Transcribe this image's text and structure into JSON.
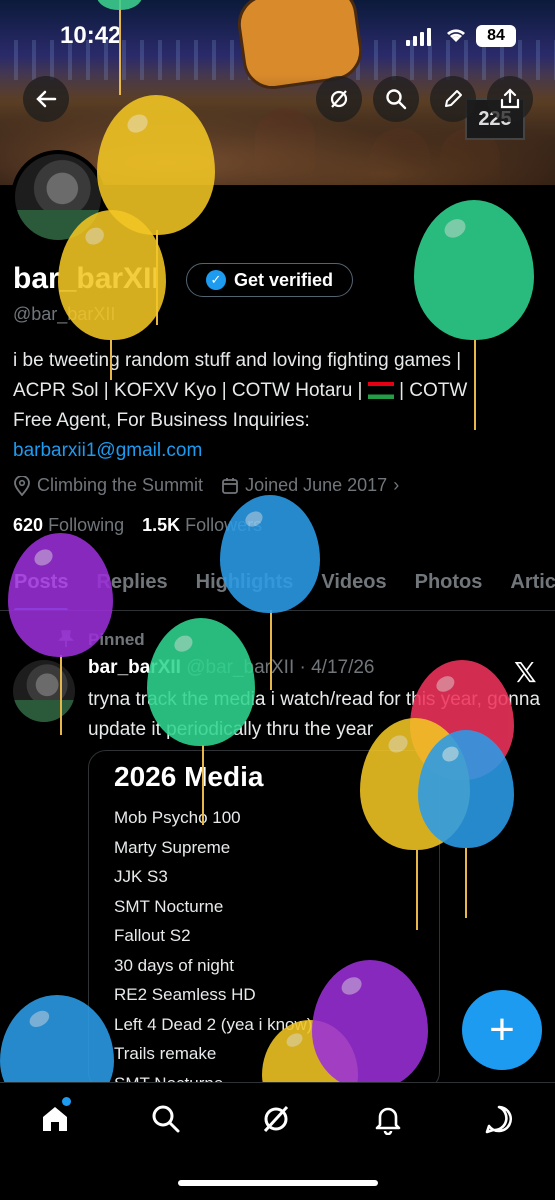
{
  "status_bar": {
    "time": "10:42",
    "battery": "84"
  },
  "banner": {
    "plate_number": "225"
  },
  "profile": {
    "display_name": "bar_barXII",
    "verify_label": "Get verified",
    "handle": "@bar_barXII",
    "bio_lines": [
      "i be tweeting random stuff and loving fighting games |",
      "ACPR Sol | KOFXV Kyo | COTW Hotaru |",
      "| COTW",
      "Free Agent, For Business Inquiries:"
    ],
    "bio_link": "barbarxii1@gmail.com",
    "location": "Climbing the Summit",
    "joined": "Joined June 2017",
    "following_count": "620",
    "following_label": "Following",
    "followers_count": "1.5K",
    "followers_label": "Followers"
  },
  "tabs": [
    "Posts",
    "Replies",
    "Highlights",
    "Videos",
    "Photos",
    "Articles"
  ],
  "post": {
    "pinned_label": "Pinned",
    "author": "bar_barXII",
    "handle_date": "@bar_barXII · 4/17/26",
    "text": "tryna track the media i watch/read for this year, gonna update it periodically thru the year",
    "card_title": "2026 Media",
    "card_items": [
      "Mob Psycho 100",
      "Marty Supreme",
      "JJK S3",
      "SMT Nocturne",
      "Fallout S2",
      "30 days of night",
      "RE2 Seamless HD",
      "Left 4 Dead 2 (yea i know)",
      "Trails remake",
      "SMT Nocturne"
    ]
  },
  "fab": {
    "label": "+"
  },
  "colors": {
    "accent": "#1d9bf0",
    "background": "#000000",
    "muted": "#71767b"
  }
}
